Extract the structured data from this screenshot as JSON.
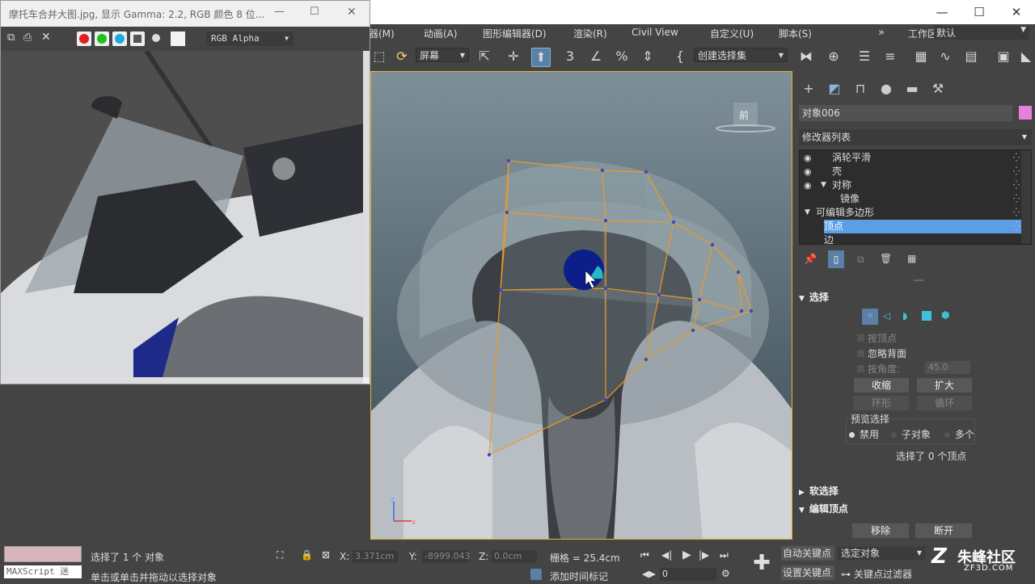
{
  "window": {
    "minimize": "—",
    "maximize": "☐",
    "close": "✕"
  },
  "menubar": {
    "items": [
      "器(M)",
      "动画(A)",
      "图形编辑器(D)",
      "渲染(R)",
      "Civil View",
      "自定义(U)",
      "脚本(S)"
    ],
    "workspace_label": "工作区:",
    "workspace_value": "默认"
  },
  "toolbar": {
    "coord_system": "屏幕",
    "selection_set": "创建选择集",
    "icons": [
      "select-region-icon",
      "rotate-view-icon",
      "select-and-link-icon",
      "move-icon",
      "select-object-icon",
      "snap-3d-icon",
      "angle-snap-icon",
      "percent-snap-icon",
      "spinner-snap-icon",
      "named-selection-icon",
      "mirror-icon",
      "align-icon",
      "layer-explorer-icon",
      "ribbon-icon",
      "schematic-icon",
      "curve-editor-icon",
      "material-editor-icon",
      "render-setup-icon",
      "render-frame-icon"
    ]
  },
  "image_viewer": {
    "title": "摩托车合并大图.jpg, 显示 Gamma: 2.2, RGB 颜色 8 位...",
    "channel": "RGB Alpha",
    "colors": {
      "red": "#e02020",
      "green": "#20c020",
      "blue": "#20a8e0"
    }
  },
  "viewport": {
    "view_cube_label": "前",
    "axis_z": "z",
    "axis_x": "x"
  },
  "panel": {
    "object_name": "对象006",
    "object_color": "#e680d8",
    "modifier_list": "修改器列表",
    "stack": [
      {
        "label": "涡轮平滑",
        "indent": 0,
        "eye": true,
        "selected": false
      },
      {
        "label": "壳",
        "indent": 0,
        "eye": true,
        "selected": false
      },
      {
        "label": "对称",
        "indent": 0,
        "eye": true,
        "selected": false,
        "expander": "▼"
      },
      {
        "label": "镜像",
        "indent": 1,
        "eye": false,
        "selected": false
      },
      {
        "label": "可编辑多边形",
        "indent": 0,
        "eye": false,
        "selected": false,
        "expander": "▼"
      },
      {
        "label": "顶点",
        "indent": 1,
        "eye": false,
        "selected": true
      },
      {
        "label": "边",
        "indent": 1,
        "eye": false,
        "selected": false
      }
    ],
    "selection": {
      "title": "选择",
      "by_vertex": "按顶点",
      "ignore_backfacing": "忽略背面",
      "by_angle": "按角度:",
      "angle_value": "45.0",
      "shrink": "收缩",
      "grow": "扩大",
      "ring": "环形",
      "loop": "循环",
      "preview_title": "预览选择",
      "preview_disabled": "禁用",
      "preview_subobject": "子对象",
      "preview_multi": "多个",
      "status": "选择了 0 个顶点"
    },
    "soft_selection": "软选择",
    "edit_vertices": {
      "title": "编辑顶点",
      "remove": "移除",
      "break": "断开"
    }
  },
  "statusbar": {
    "maxscript": "MAXScript 迷",
    "selected_objects": "选择了 1 个 对象",
    "hint": "单击或单击并拖动以选择对象",
    "x_label": "X:",
    "x_value": "3.371cm",
    "y_label": "Y:",
    "y_value": "-8999.043",
    "z_label": "Z:",
    "z_value": "0.0cm",
    "grid": "栅格 = 25.4cm",
    "add_time_tag": "添加时间标记",
    "frame": "0",
    "auto_key": "自动关键点",
    "set_key": "设置关键点",
    "selected_object": "选定对象",
    "key_filters": "关键点过滤器",
    "watermark_cn": "朱峰社区",
    "watermark_url": "ZF3D.COM"
  }
}
